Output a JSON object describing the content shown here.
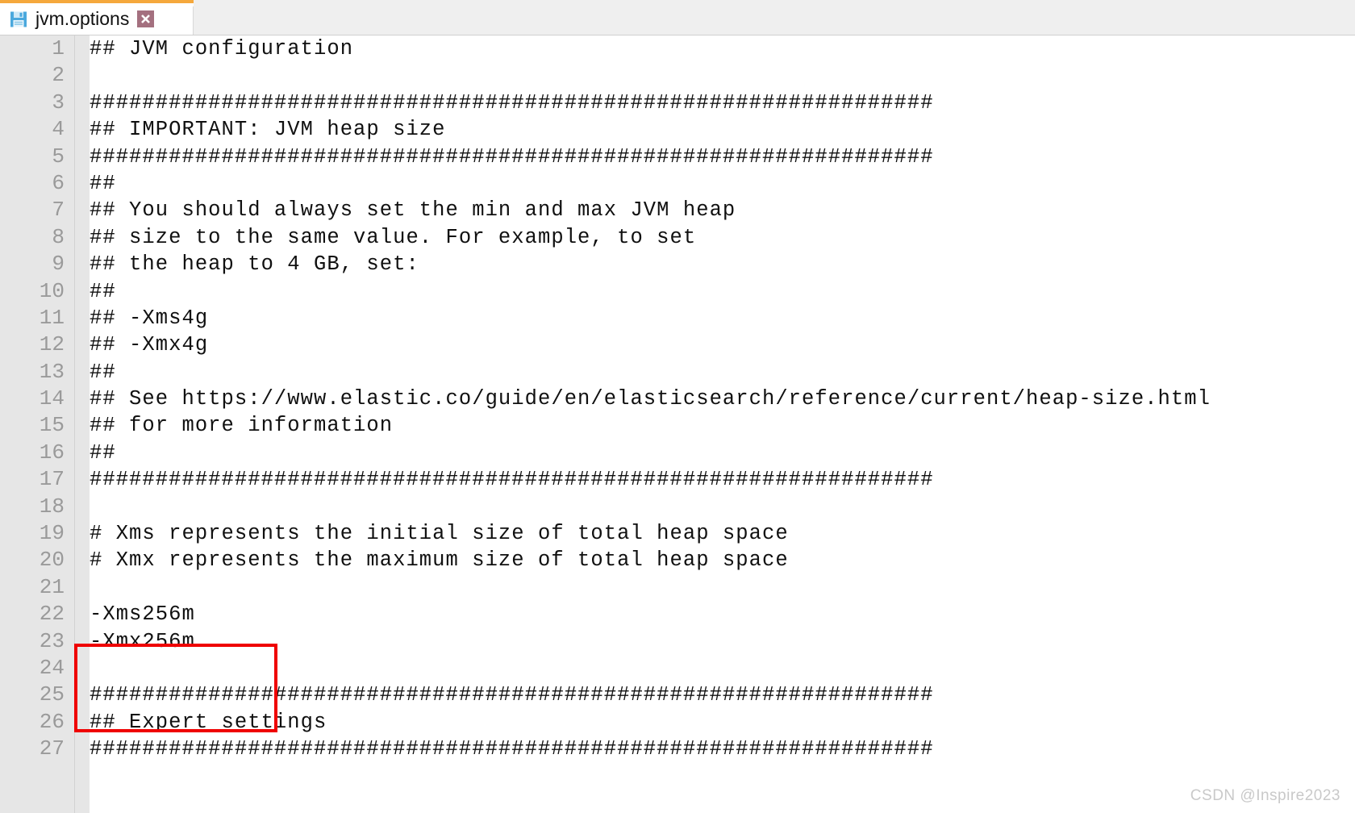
{
  "window": {
    "accent_color": "#f5a83c",
    "tab_background": "#efefef",
    "gutter_background": "#e6e6e6",
    "line_number_color": "#9a9a9a",
    "text_color": "#101010",
    "annotation_color": "#ef0000"
  },
  "tab": {
    "title": "jvm.options",
    "save_icon": "floppy-disk-save-icon",
    "close_icon": "close-x-icon"
  },
  "editor": {
    "lines": [
      {
        "num": "1",
        "text": "## JVM configuration"
      },
      {
        "num": "2",
        "text": ""
      },
      {
        "num": "3",
        "text": "################################################################"
      },
      {
        "num": "4",
        "text": "## IMPORTANT: JVM heap size"
      },
      {
        "num": "5",
        "text": "################################################################"
      },
      {
        "num": "6",
        "text": "##"
      },
      {
        "num": "7",
        "text": "## You should always set the min and max JVM heap"
      },
      {
        "num": "8",
        "text": "## size to the same value. For example, to set"
      },
      {
        "num": "9",
        "text": "## the heap to 4 GB, set:"
      },
      {
        "num": "10",
        "text": "##"
      },
      {
        "num": "11",
        "text": "## -Xms4g"
      },
      {
        "num": "12",
        "text": "## -Xmx4g"
      },
      {
        "num": "13",
        "text": "##"
      },
      {
        "num": "14",
        "text": "## See https://www.elastic.co/guide/en/elasticsearch/reference/current/heap-size.html"
      },
      {
        "num": "15",
        "text": "## for more information"
      },
      {
        "num": "16",
        "text": "##"
      },
      {
        "num": "17",
        "text": "################################################################"
      },
      {
        "num": "18",
        "text": ""
      },
      {
        "num": "19",
        "text": "# Xms represents the initial size of total heap space"
      },
      {
        "num": "20",
        "text": "# Xmx represents the maximum size of total heap space"
      },
      {
        "num": "21",
        "text": ""
      },
      {
        "num": "22",
        "text": "-Xms256m"
      },
      {
        "num": "23",
        "text": "-Xmx256m"
      },
      {
        "num": "24",
        "text": ""
      },
      {
        "num": "25",
        "text": "################################################################"
      },
      {
        "num": "26",
        "text": "## Expert settings"
      },
      {
        "num": "27",
        "text": "################################################################"
      }
    ]
  },
  "annotation": {
    "label": "highlight-box-heap-size-settings"
  },
  "watermark": {
    "text": "CSDN @Inspire2023"
  }
}
